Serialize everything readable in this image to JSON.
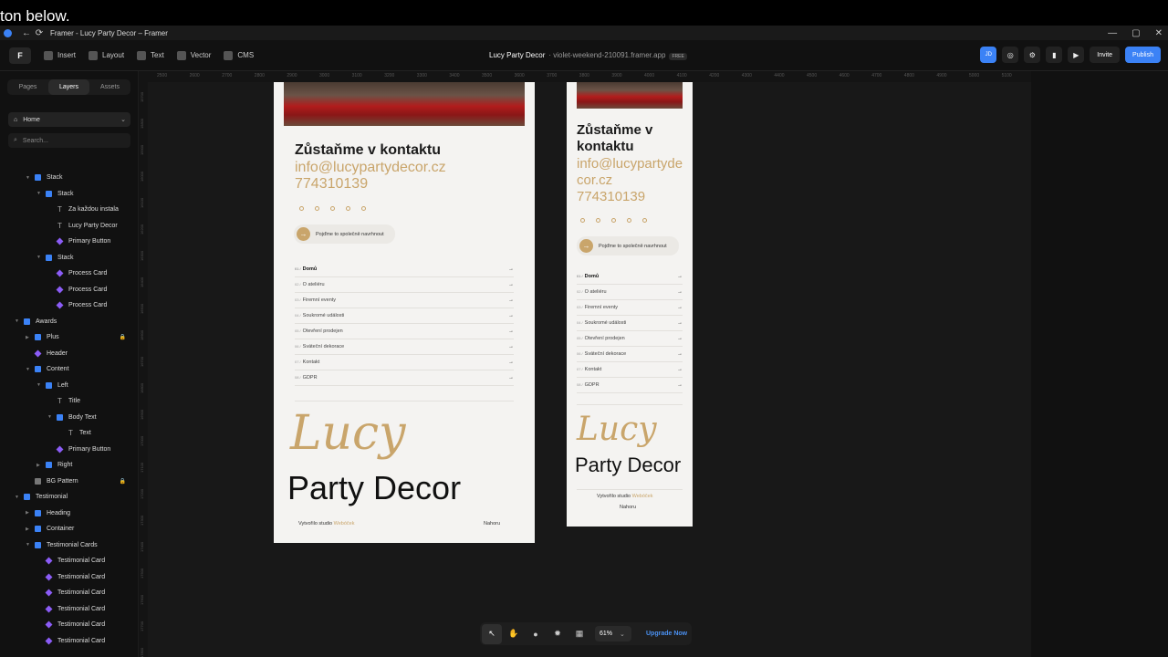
{
  "caption": "ton below.",
  "browser": {
    "tab_title": "Framer - Lucy Party Decor – Framer",
    "back": "←",
    "reload": "⟳",
    "win_min": "—",
    "win_max": "▢",
    "win_close": "✕"
  },
  "toolbar": {
    "insert": "Insert",
    "layout": "Layout",
    "text": "Text",
    "vector": "Vector",
    "cms": "CMS",
    "project_name": "Lucy Party Decor",
    "domain": "· violet-weekend-210091.framer.app",
    "free_badge": "FREE",
    "avatar": "JD",
    "globe": "◎",
    "settings": "⚙",
    "analytics": "▮",
    "play": "▶",
    "invite": "Invite",
    "publish": "Publish"
  },
  "sidebar": {
    "tabs": [
      "Pages",
      "Layers",
      "Assets"
    ],
    "page_select": "Home",
    "search_placeholder": "Search...",
    "layers": [
      {
        "label": "Stack",
        "icon": "stack",
        "depth": 1,
        "open": true
      },
      {
        "label": "Stack",
        "icon": "stack",
        "depth": 2,
        "open": true
      },
      {
        "label": "Za každou instala",
        "icon": "text",
        "depth": 3
      },
      {
        "label": "Lucy Party Decor",
        "icon": "text",
        "depth": 3
      },
      {
        "label": "Primary Button",
        "icon": "comp",
        "depth": 3
      },
      {
        "label": "Stack",
        "icon": "stack",
        "depth": 2,
        "open": true
      },
      {
        "label": "Process Card",
        "icon": "comp",
        "depth": 3
      },
      {
        "label": "Process Card",
        "icon": "comp",
        "depth": 3
      },
      {
        "label": "Process Card",
        "icon": "comp",
        "depth": 3
      },
      {
        "label": "Awards",
        "icon": "stack",
        "depth": 0,
        "open": true
      },
      {
        "label": "Plus",
        "icon": "stack",
        "depth": 1,
        "closed": true,
        "locked": true
      },
      {
        "label": "Header",
        "icon": "comp",
        "depth": 1
      },
      {
        "label": "Content",
        "icon": "stack",
        "depth": 1,
        "open": true
      },
      {
        "label": "Left",
        "icon": "stack",
        "depth": 2,
        "open": true
      },
      {
        "label": "Title",
        "icon": "text",
        "depth": 3
      },
      {
        "label": "Body Text",
        "icon": "stack",
        "depth": 3,
        "open": true
      },
      {
        "label": "Text",
        "icon": "text",
        "depth": 4
      },
      {
        "label": "Primary Button",
        "icon": "comp",
        "depth": 3
      },
      {
        "label": "Right",
        "icon": "stack",
        "depth": 2,
        "closed": true
      },
      {
        "label": "BG Pattern",
        "icon": "pat",
        "depth": 1,
        "locked": true
      },
      {
        "label": "Testimonial",
        "icon": "stack",
        "depth": 0,
        "open": true
      },
      {
        "label": "Heading",
        "icon": "stack",
        "depth": 1,
        "closed": true
      },
      {
        "label": "Container",
        "icon": "stack",
        "depth": 1,
        "closed": true
      },
      {
        "label": "Testimonial Cards",
        "icon": "stack",
        "depth": 1,
        "open": true
      },
      {
        "label": "Testimonial Card",
        "icon": "comp",
        "depth": 2
      },
      {
        "label": "Testimonial Card",
        "icon": "comp",
        "depth": 2
      },
      {
        "label": "Testimonial Card",
        "icon": "comp",
        "depth": 2
      },
      {
        "label": "Testimonial Card",
        "icon": "comp",
        "depth": 2
      },
      {
        "label": "Testimonial Card",
        "icon": "comp",
        "depth": 2
      },
      {
        "label": "Testimonial Card",
        "icon": "comp",
        "depth": 2
      }
    ]
  },
  "rulers": {
    "top": [
      "2500",
      "2600",
      "2700",
      "2800",
      "2900",
      "3000",
      "3100",
      "3200",
      "3300",
      "3400",
      "3500",
      "3600",
      "3700",
      "3800",
      "3900",
      "4000",
      "4100",
      "4200",
      "4300",
      "4400",
      "4500",
      "4600",
      "4700",
      "4800",
      "4900",
      "5000",
      "5100"
    ],
    "left": [
      "15700",
      "15800",
      "15900",
      "16000",
      "16100",
      "16200",
      "16300",
      "16400",
      "16500",
      "16600",
      "16700",
      "16800",
      "16900",
      "17000",
      "17100",
      "17200",
      "17300",
      "17400",
      "17500",
      "17600",
      "17700",
      "17800"
    ]
  },
  "site": {
    "contact_heading": "Zůstaňme v kontaktu",
    "email": "info@lucypartydecor.cz",
    "phone": "774310139",
    "cta_label": "Pojďme to společně navrhnout",
    "cta_arrow": "→",
    "menu": [
      {
        "num": "01 /",
        "label": "Domů"
      },
      {
        "num": "02 /",
        "label": "O ateliéru"
      },
      {
        "num": "03 /",
        "label": "Firemní eventy"
      },
      {
        "num": "04 /",
        "label": "Soukromé události"
      },
      {
        "num": "05 /",
        "label": "Otevření prodejen"
      },
      {
        "num": "06 /",
        "label": "Sváteční dekorace"
      },
      {
        "num": "07 /",
        "label": "Kontakt"
      },
      {
        "num": "08 /",
        "label": "GDPR"
      }
    ],
    "menu_arrow": "→",
    "logo_script": "Lucy",
    "logo_text": "Party Decor",
    "footer_made_by": "Vytvořilo studio",
    "footer_studio": "Webóček",
    "footer_top": "Nahoru"
  },
  "zoombar": {
    "select_icon": "↖",
    "hand_icon": "✋",
    "comment_icon": "●",
    "theme_icon": "✹",
    "grid_icon": "▦",
    "zoom": "61%",
    "zoom_chevron": "⌄",
    "upgrade": "Upgrade Now"
  },
  "colors": {
    "accent": "#3b82f6",
    "gold": "#c9a56b",
    "frame_bg": "#f4f3f1"
  }
}
